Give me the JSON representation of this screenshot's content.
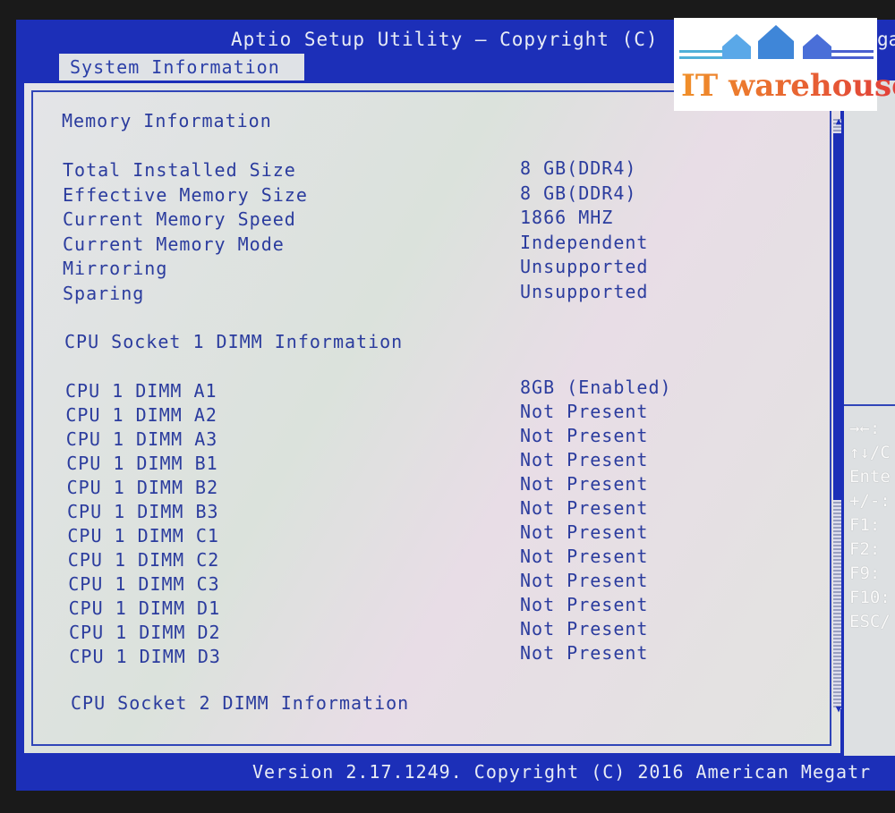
{
  "header": {
    "title": "Aptio Setup Utility – Copyright (C)",
    "title_cut": "ga"
  },
  "tab": {
    "label": "System Information"
  },
  "memory": {
    "heading": "Memory Information",
    "items": [
      {
        "label": "Total Installed Size",
        "value": "8 GB(DDR4)"
      },
      {
        "label": "Effective Memory Size",
        "value": "8 GB(DDR4)"
      },
      {
        "label": "Current Memory Speed",
        "value": "1866 MHZ"
      },
      {
        "label": "Current Memory Mode",
        "value": "Independent"
      },
      {
        "label": "Mirroring",
        "value": "Unsupported"
      },
      {
        "label": "Sparing",
        "value": "Unsupported"
      }
    ]
  },
  "socket1": {
    "heading": "CPU Socket 1 DIMM Information",
    "dimms": [
      {
        "label": "CPU 1 DIMM A1",
        "value": "8GB (Enabled)"
      },
      {
        "label": "CPU 1 DIMM A2",
        "value": "Not Present"
      },
      {
        "label": "CPU 1 DIMM A3",
        "value": "Not Present"
      },
      {
        "label": "CPU 1 DIMM B1",
        "value": "Not Present"
      },
      {
        "label": "CPU 1 DIMM B2",
        "value": "Not Present"
      },
      {
        "label": "CPU 1 DIMM B3",
        "value": "Not Present"
      },
      {
        "label": "CPU 1 DIMM C1",
        "value": "Not Present"
      },
      {
        "label": "CPU 1 DIMM C2",
        "value": "Not Present"
      },
      {
        "label": "CPU 1 DIMM C3",
        "value": "Not Present"
      },
      {
        "label": "CPU 1 DIMM D1",
        "value": "Not Present"
      },
      {
        "label": "CPU 1 DIMM D2",
        "value": "Not Present"
      },
      {
        "label": "CPU 1 DIMM D3",
        "value": "Not Present"
      }
    ]
  },
  "socket2": {
    "heading": "CPU Socket 2 DIMM Information"
  },
  "help_keys": [
    "→←:",
    "↑↓/C",
    "Ente",
    "+/-:",
    "F1:",
    "F2:",
    "F9:",
    "F10:",
    "ESC/"
  ],
  "footer": {
    "text": "Version 2.17.1249. Copyright (C) 2016 American Megatr"
  },
  "watermark": {
    "text": "IT warehouse"
  },
  "colors": {
    "bios_blue": "#1c2fb8",
    "text_blue": "#2b3c9e",
    "panel": "#dfe2e6"
  }
}
